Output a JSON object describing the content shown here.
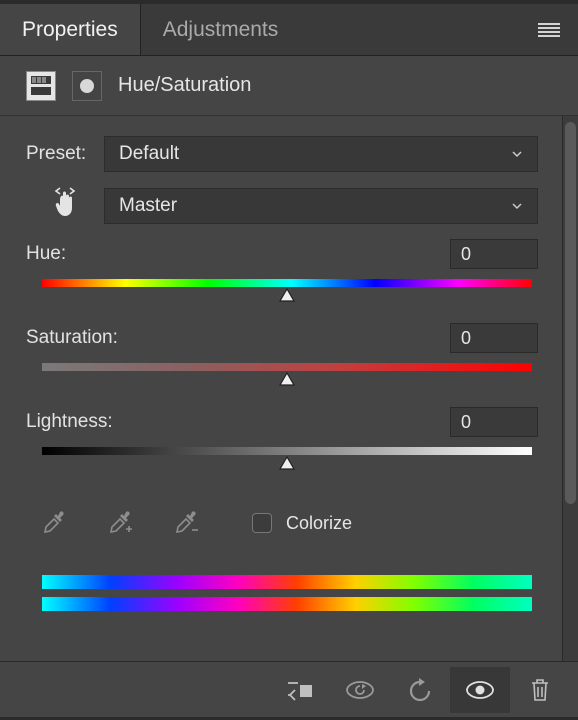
{
  "tabs": {
    "properties": "Properties",
    "adjustments": "Adjustments"
  },
  "adjustment_type": "Hue/Saturation",
  "preset": {
    "label": "Preset:",
    "value": "Default"
  },
  "range": {
    "value": "Master"
  },
  "sliders": {
    "hue": {
      "label": "Hue:",
      "value": "0"
    },
    "saturation": {
      "label": "Saturation:",
      "value": "0"
    },
    "lightness": {
      "label": "Lightness:",
      "value": "0"
    }
  },
  "colorize": {
    "label": "Colorize",
    "checked": false
  },
  "icons": {
    "menu": "menu-icon",
    "hand": "hand-scrubber-icon",
    "eyedropper": "eyedropper-icon",
    "eyedropper_add": "eyedropper-add-icon",
    "eyedropper_sub": "eyedropper-subtract-icon",
    "clip": "clip-to-layer-icon",
    "prev_state": "view-previous-icon",
    "reset": "reset-icon",
    "visibility": "visibility-icon",
    "trash": "trash-icon"
  }
}
